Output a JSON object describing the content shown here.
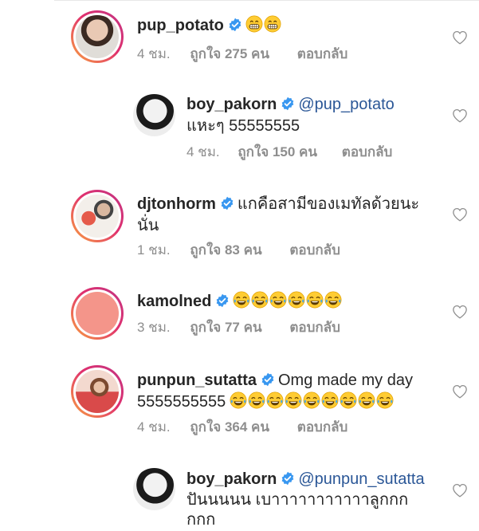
{
  "comments": [
    {
      "username": "pup_potato",
      "text": "",
      "emoji": [
        "grin",
        "grin"
      ],
      "time": "4 ชม.",
      "likes": "ถูกใจ 275 คน",
      "reply": "ตอบกลับ"
    },
    {
      "username": "boy_pakorn",
      "mention": "@pup_potato",
      "text": "แหะๆ 55555555",
      "time": "4 ชม.",
      "likes": "ถูกใจ 150 คน",
      "reply": "ตอบกลับ"
    },
    {
      "username": "djtonhorm",
      "text_line1": "แกคือสามีของเมทัลด้วยนะ",
      "text_line2": "นั่น",
      "time": "1 ชม.",
      "likes": "ถูกใจ 83 คน",
      "reply": "ตอบกลับ"
    },
    {
      "username": "kamolned",
      "emoji": [
        "joy",
        "joy",
        "joy",
        "joy",
        "joy",
        "joy"
      ],
      "time": "3 ชม.",
      "likes": "ถูกใจ 77 คน",
      "reply": "ตอบกลับ"
    },
    {
      "username": "punpun_sutatta",
      "text_line1": "Omg made my day",
      "text_line2": "5555555555",
      "emoji": [
        "joy",
        "joy",
        "joy",
        "joy",
        "joy",
        "joy",
        "joy",
        "joy",
        "joy"
      ],
      "time": "4 ชม.",
      "likes": "ถูกใจ 364 คน",
      "reply": "ตอบกลับ"
    },
    {
      "username": "boy_pakorn",
      "mention": "@punpun_sutatta",
      "text_line1": "ปันนนนน เบาาาาาาาาาาาลูกกก",
      "text_line2": "กกก"
    }
  ],
  "colors": {
    "mention": "#2b5797",
    "verified": "#3897f0",
    "meta": "#8e8e8e",
    "kamolned_avatar": "#f4958a"
  }
}
